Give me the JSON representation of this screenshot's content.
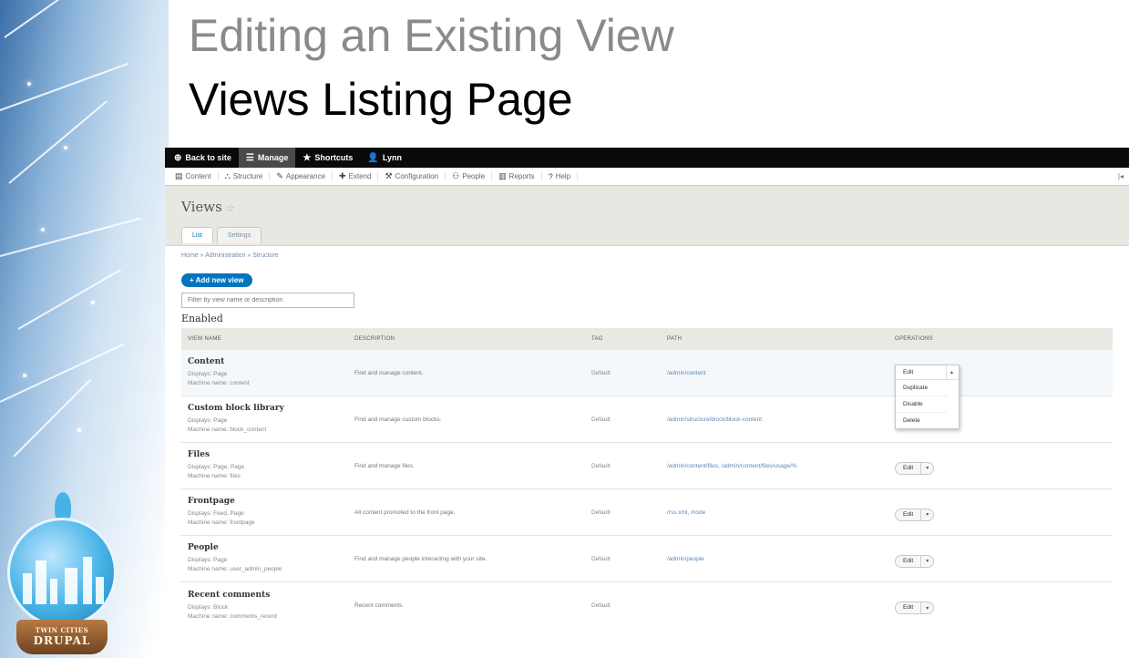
{
  "slide": {
    "title_line1": "Editing an Existing View",
    "title_line2": "Views Listing Page",
    "badge_line1": "TWIN CITIES",
    "badge_line2": "DRUPAL"
  },
  "toolbar": [
    {
      "label": "Back to site",
      "icon": "globe-icon"
    },
    {
      "label": "Manage",
      "icon": "menu-icon"
    },
    {
      "label": "Shortcuts",
      "icon": "star-icon"
    },
    {
      "label": "Lynn",
      "icon": "user-icon"
    }
  ],
  "menubar": [
    {
      "label": "Content",
      "icon": "content-icon"
    },
    {
      "label": "Structure",
      "icon": "structure-icon"
    },
    {
      "label": "Appearance",
      "icon": "appearance-icon"
    },
    {
      "label": "Extend",
      "icon": "extend-icon"
    },
    {
      "label": "Configuration",
      "icon": "wrench-icon"
    },
    {
      "label": "People",
      "icon": "people-icon"
    },
    {
      "label": "Reports",
      "icon": "reports-icon"
    },
    {
      "label": "Help",
      "icon": "help-icon"
    }
  ],
  "page": {
    "title": "Views",
    "tabs": [
      "List",
      "Settings"
    ],
    "breadcrumb": "Home » Administration » Structure",
    "add_button": "+ Add new view",
    "filter_placeholder": "Filter by view name or description",
    "section": "Enabled"
  },
  "table": {
    "headers": [
      "VIEW NAME",
      "DESCRIPTION",
      "TAG",
      "PATH",
      "OPERATIONS"
    ],
    "rows": [
      {
        "name": "Content",
        "displays": "Displays: Page",
        "machine": "Machine name: content",
        "description": "Find and manage content.",
        "tag": "Default",
        "path": "/admin/content"
      },
      {
        "name": "Custom block library",
        "displays": "Displays: Page",
        "machine": "Machine name: block_content",
        "description": "Find and manage custom blocks.",
        "tag": "Default",
        "path": "/admin/structure/block/block-content"
      },
      {
        "name": "Files",
        "displays": "Displays: Page, Page",
        "machine": "Machine name: files",
        "description": "Find and manage files.",
        "tag": "Default",
        "path": "/admin/content/files, /admin/content/files/usage/%"
      },
      {
        "name": "Frontpage",
        "displays": "Displays: Feed, Page",
        "machine": "Machine name: frontpage",
        "description": "All content promoted to the front page.",
        "tag": "Default",
        "path": "/rss.xml, /node"
      },
      {
        "name": "People",
        "displays": "Displays: Page",
        "machine": "Machine name: user_admin_people",
        "description": "Find and manage people interacting with your site.",
        "tag": "Default",
        "path": "/admin/people"
      },
      {
        "name": "Recent comments",
        "displays": "Displays: Block",
        "machine": "Machine name: comments_recent",
        "description": "Recent comments.",
        "tag": "Default",
        "path": ""
      }
    ],
    "edit_label": "Edit"
  },
  "dropdown": {
    "edit": "Edit",
    "items": [
      "Duplicate",
      "Disable",
      "Delete"
    ]
  }
}
